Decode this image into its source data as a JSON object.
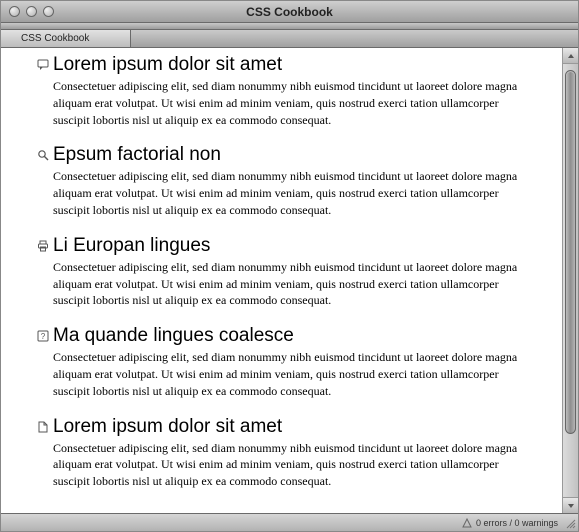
{
  "window": {
    "title": "CSS Cookbook",
    "tab_label": "CSS Cookbook"
  },
  "sections": [
    {
      "icon": "speech-bubble-icon",
      "heading": "Lorem ipsum dolor sit amet",
      "body": "Consectetuer adipiscing elit, sed diam nonummy nibh euismod tincidunt ut laoreet dolore magna aliquam erat volutpat. Ut wisi enim ad minim veniam, quis nostrud exerci tation ullamcorper suscipit lobortis nisl ut aliquip ex ea commodo consequat."
    },
    {
      "icon": "magnifier-icon",
      "heading": "Epsum factorial non",
      "body": "Consectetuer adipiscing elit, sed diam nonummy nibh euismod tincidunt ut laoreet dolore magna aliquam erat volutpat. Ut wisi enim ad minim veniam, quis nostrud exerci tation ullamcorper suscipit lobortis nisl ut aliquip ex ea commodo consequat."
    },
    {
      "icon": "printer-icon",
      "heading": "Li Europan lingues",
      "body": "Consectetuer adipiscing elit, sed diam nonummy nibh euismod tincidunt ut laoreet dolore magna aliquam erat volutpat. Ut wisi enim ad minim veniam, quis nostrud exerci tation ullamcorper suscipit lobortis nisl ut aliquip ex ea commodo consequat."
    },
    {
      "icon": "help-square-icon",
      "heading": "Ma quande lingues coalesce",
      "body": "Consectetuer adipiscing elit, sed diam nonummy nibh euismod tincidunt ut laoreet dolore magna aliquam erat volutpat. Ut wisi enim ad minim veniam, quis nostrud exerci tation ullamcorper suscipit lobortis nisl ut aliquip ex ea commodo consequat."
    },
    {
      "icon": "document-icon",
      "heading": "Lorem ipsum dolor sit amet",
      "body": "Consectetuer adipiscing elit, sed diam nonummy nibh euismod tincidunt ut laoreet dolore magna aliquam erat volutpat. Ut wisi enim ad minim veniam, quis nostrud exerci tation ullamcorper suscipit lobortis nisl ut aliquip ex ea commodo consequat."
    }
  ],
  "status": {
    "text": "0 errors / 0 warnings"
  }
}
